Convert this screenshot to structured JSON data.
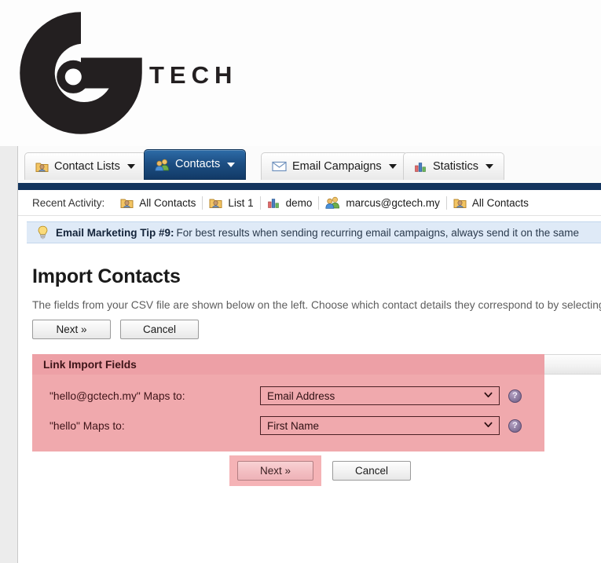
{
  "brand": {
    "name": "G TECH",
    "wordmark": "TECH",
    "logo_color": "#231f20"
  },
  "tabs": [
    {
      "label": "Contact Lists",
      "icon": "contact-list-icon",
      "active": false,
      "has_caret": true
    },
    {
      "label": "Contacts",
      "icon": "contacts-people-icon",
      "active": true,
      "has_caret": true
    },
    {
      "label": "Email Campaigns",
      "icon": "envelope-icon",
      "active": false,
      "has_caret": true
    },
    {
      "label": "Statistics",
      "icon": "bar-chart-icon",
      "active": false,
      "has_caret": true
    }
  ],
  "recent_activity": {
    "label": "Recent Activity:",
    "items": [
      {
        "label": "All Contacts",
        "icon": "contact-list-icon"
      },
      {
        "label": "List 1",
        "icon": "contact-list-icon"
      },
      {
        "label": "demo",
        "icon": "bar-chart-icon"
      },
      {
        "label": "marcus@gctech.my",
        "icon": "contacts-people-icon"
      },
      {
        "label": "All Contacts",
        "icon": "contact-list-icon"
      }
    ]
  },
  "tip": {
    "icon": "lightbulb-icon",
    "heading": "Email Marketing Tip #9:",
    "body": "For best results when sending recurring email campaigns, always send it on the same"
  },
  "page": {
    "title": "Import Contacts",
    "description": "The fields from your CSV file are shown below on the left. Choose which contact details they correspond to by selecting"
  },
  "top_buttons": {
    "next_label": "Next »",
    "cancel_label": "Cancel"
  },
  "panel": {
    "title": "Link Import Fields",
    "background_color": "#f0a9ad",
    "header_color": "#eda0a6",
    "rows": [
      {
        "label": "\"hello@gctech.my\" Maps to:",
        "selected": "Email Address",
        "help_icon": "help-question-icon"
      },
      {
        "label": "\"hello\" Maps to:",
        "selected": "First Name",
        "help_icon": "help-question-icon"
      }
    ]
  },
  "bottom_buttons": {
    "next_label": "Next »",
    "cancel_label": "Cancel",
    "next_highlight_color": "#f5b3b6"
  }
}
